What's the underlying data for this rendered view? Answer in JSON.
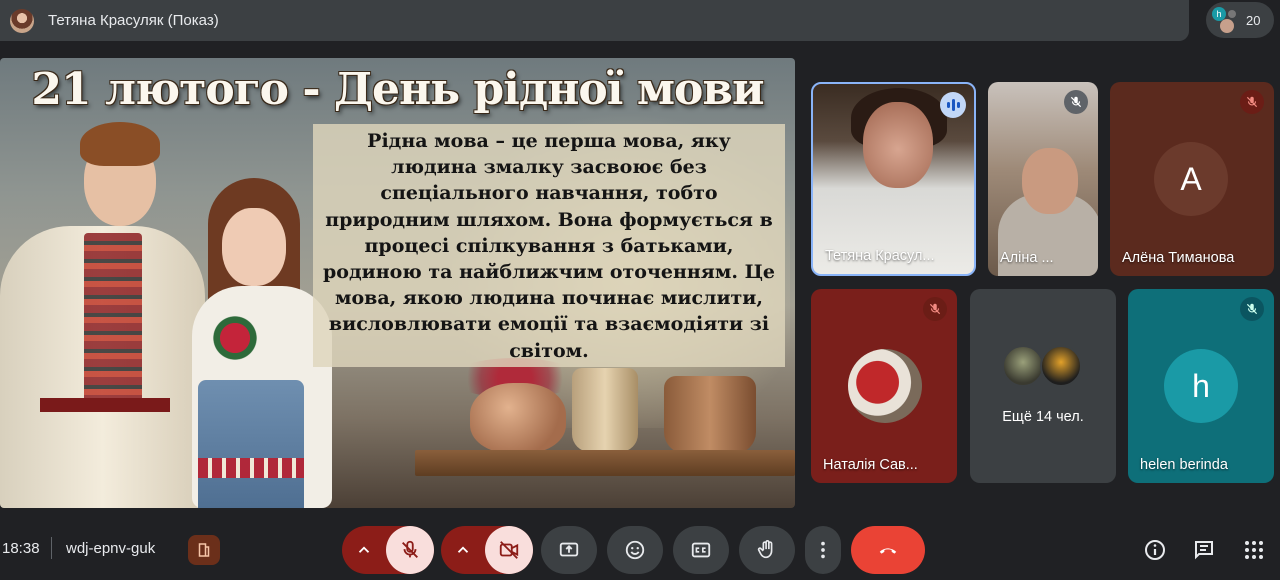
{
  "topbar": {
    "title": "Тетяна Красуляк (Показ)"
  },
  "people_chip": {
    "avatar_initial": "h",
    "count": "20"
  },
  "slide": {
    "title": "21 лютого - День рідної мови",
    "body": "Рідна мова – це перша мова, яку людина змалку засвоює без спеціального навчання, тобто природним шляхом. Вона формується в процесі спілкування з батьками, родиною та найближчим оточенням. Це мова, якою людина починає мислити, висловлювати емоції та взаємодіяти зі світом."
  },
  "participants": [
    {
      "name": "Тетяна Красул...",
      "state": "speaking"
    },
    {
      "name": "Аліна ...",
      "state": "muted"
    },
    {
      "name": "Алёна Тиманова",
      "initial": "A",
      "state": "muted",
      "color": "#5b2a1e"
    },
    {
      "name": "Наталія Сав...",
      "state": "muted",
      "color": "#7a1f1b"
    },
    {
      "more_label": "Ещё 14 чел."
    },
    {
      "name": "helen berinda",
      "initial": "h",
      "state": "muted",
      "color": "#0e6f79"
    }
  ],
  "bottom": {
    "time": "18:38",
    "meeting_code": "wdj-epnv-guk"
  },
  "colors": {
    "accent_red": "#ea4335",
    "muted_pill": "#8c1d18",
    "bar_bg": "#202124"
  }
}
